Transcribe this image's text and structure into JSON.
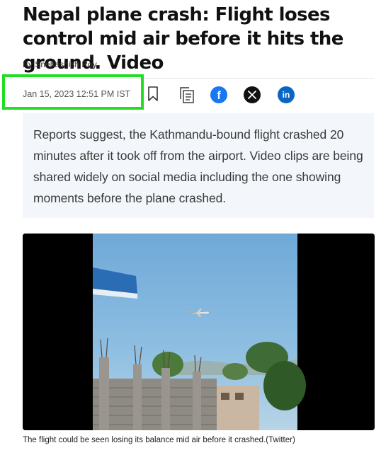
{
  "article": {
    "headline": "Nepal plane crash: Flight loses control mid air before it hits the ground. Video",
    "byline": "By Snehashish Roy",
    "date": "Jan 15, 2023 12:51 PM IST",
    "summary": "Reports suggest, the Kathmandu-bound flight crashed 20 minutes after it took off from the airport. Video clips are being shared widely on social media including the one showing moments before the plane crashed.",
    "caption": "The flight could be seen losing its balance mid air before it crashed.(Twitter)"
  },
  "share": {
    "icons": [
      "bookmark-icon",
      "copy-icon",
      "facebook-icon",
      "x-icon",
      "linkedin-icon"
    ],
    "facebook_glyph": "f",
    "linkedin_glyph": "in",
    "x_glyph": "𝕏"
  },
  "colors": {
    "highlight": "#22dd22",
    "facebook": "#1877f2",
    "linkedin": "#0a66c2",
    "summary_bg": "#f3f7fb"
  }
}
